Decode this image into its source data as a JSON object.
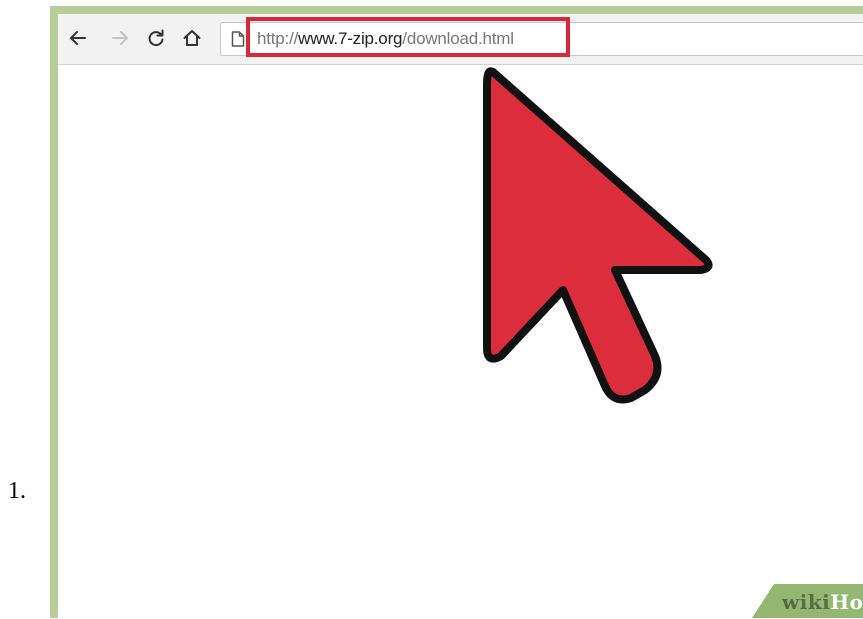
{
  "step": {
    "number": "1."
  },
  "browser": {
    "toolbar": {
      "back_icon": "arrow-left-icon",
      "forward_icon": "arrow-right-icon",
      "reload_icon": "reload-icon",
      "home_icon": "home-icon",
      "page_icon": "page-icon"
    },
    "address_bar": {
      "scheme": "http://",
      "host": "www.7-zip.org",
      "path": "/download.html",
      "highlight_color": "#d8283a"
    }
  },
  "overlay": {
    "cursor_icon": "mouse-pointer-icon",
    "cursor_color": "#dc2d3c"
  },
  "watermark": {
    "wiki": "wiki",
    "how": "How"
  },
  "colors": {
    "frame": "#b7cd9a",
    "toolbar": "#f2f2f2"
  }
}
